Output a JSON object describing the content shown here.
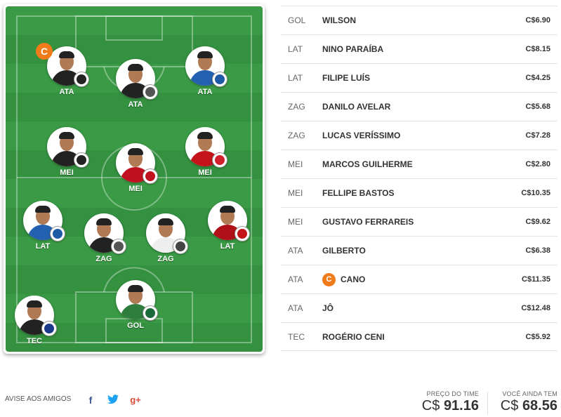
{
  "field": {
    "players": [
      {
        "pos": "ATA",
        "team": "vasco",
        "captain": true
      },
      {
        "pos": "ATA",
        "team": "corinthians",
        "captain": false
      },
      {
        "pos": "ATA",
        "team": "bahia",
        "captain": false
      },
      {
        "pos": "MEI",
        "team": "vasco",
        "captain": false
      },
      {
        "pos": "MEI",
        "team": "atletico-go",
        "captain": false
      },
      {
        "pos": "MEI",
        "team": "internacional",
        "captain": false
      },
      {
        "pos": "LAT",
        "team": "bahia",
        "captain": false
      },
      {
        "pos": "ZAG",
        "team": "corinthians",
        "captain": false
      },
      {
        "pos": "ZAG",
        "team": "santos",
        "captain": false
      },
      {
        "pos": "LAT",
        "team": "flamengo",
        "captain": false
      },
      {
        "pos": "GOL",
        "team": "coritiba",
        "captain": false
      },
      {
        "pos": "TEC",
        "team": "fortaleza",
        "captain": false
      }
    ],
    "captain_letter": "C"
  },
  "roster": [
    {
      "pos": "GOL",
      "name": "WILSON",
      "price": "C$6.90",
      "captain": false
    },
    {
      "pos": "LAT",
      "name": "NINO PARAÍBA",
      "price": "C$8.15",
      "captain": false
    },
    {
      "pos": "LAT",
      "name": "FILIPE LUÍS",
      "price": "C$4.25",
      "captain": false
    },
    {
      "pos": "ZAG",
      "name": "DANILO AVELAR",
      "price": "C$5.68",
      "captain": false
    },
    {
      "pos": "ZAG",
      "name": "LUCAS VERÍSSIMO",
      "price": "C$7.28",
      "captain": false
    },
    {
      "pos": "MEI",
      "name": "MARCOS GUILHERME",
      "price": "C$2.80",
      "captain": false
    },
    {
      "pos": "MEI",
      "name": "FELLIPE BASTOS",
      "price": "C$10.35",
      "captain": false
    },
    {
      "pos": "MEI",
      "name": "GUSTAVO FERRAREIS",
      "price": "C$9.62",
      "captain": false
    },
    {
      "pos": "ATA",
      "name": "GILBERTO",
      "price": "C$6.38",
      "captain": false
    },
    {
      "pos": "ATA",
      "name": "CANO",
      "price": "C$11.35",
      "captain": true
    },
    {
      "pos": "ATA",
      "name": "JÔ",
      "price": "C$12.48",
      "captain": false
    },
    {
      "pos": "TEC",
      "name": "ROGÉRIO CENI",
      "price": "C$5.92",
      "captain": false
    }
  ],
  "footer": {
    "share_label": "AVISE AOS AMIGOS",
    "share_icons": [
      "facebook-icon",
      "twitter-icon",
      "google-plus-icon"
    ],
    "facebook_glyph": "f",
    "google_glyph": "g+",
    "team_price_label": "PREÇO DO TIME",
    "team_price_currency": "C$",
    "team_price_value": "91.16",
    "remaining_label": "VOCÊ AINDA TEM",
    "remaining_currency": "C$",
    "remaining_value": "68.56"
  },
  "colors": {
    "accent": "#f07b1a",
    "field_green": "#3a9a45"
  }
}
